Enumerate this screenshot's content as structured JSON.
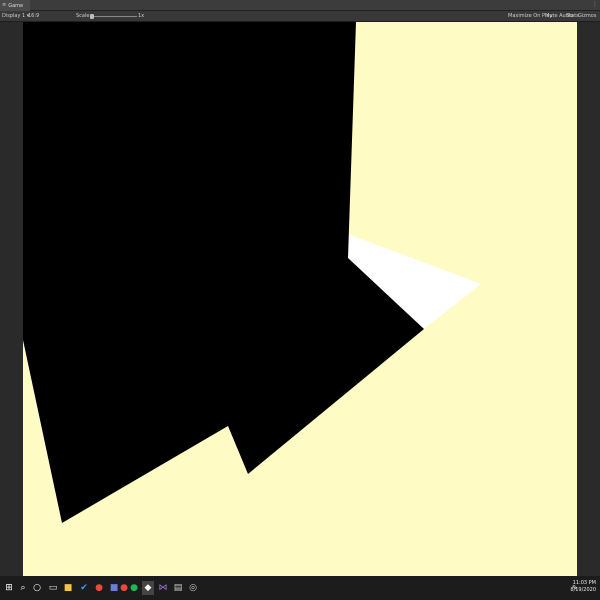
{
  "tab": {
    "icon": "gamepad-icon",
    "label": "Game"
  },
  "toolbar": {
    "display": "Display 1",
    "resolution": "16:9",
    "scale_label": "Scale",
    "scale_value": "1x",
    "maximize": "Maximize On Play",
    "mute": "Mute Audio",
    "stats": "Stats",
    "gizmos": "Gizmos"
  },
  "viewport": {
    "background": "#fffbc4",
    "shape_dark": "#000000",
    "shape_light": "#ffffff"
  },
  "taskbar": {
    "icons": [
      "windows-start-icon",
      "search-icon",
      "cortana-icon",
      "file-explorer-icon",
      "check-app-icon",
      "chrome-icon",
      "teams-icon",
      "spotify-icon",
      "unity-icon",
      "visual-studio-icon",
      "app-icon",
      "settings-icon"
    ],
    "time": "11:03 PM",
    "date": "8/19/2020"
  }
}
